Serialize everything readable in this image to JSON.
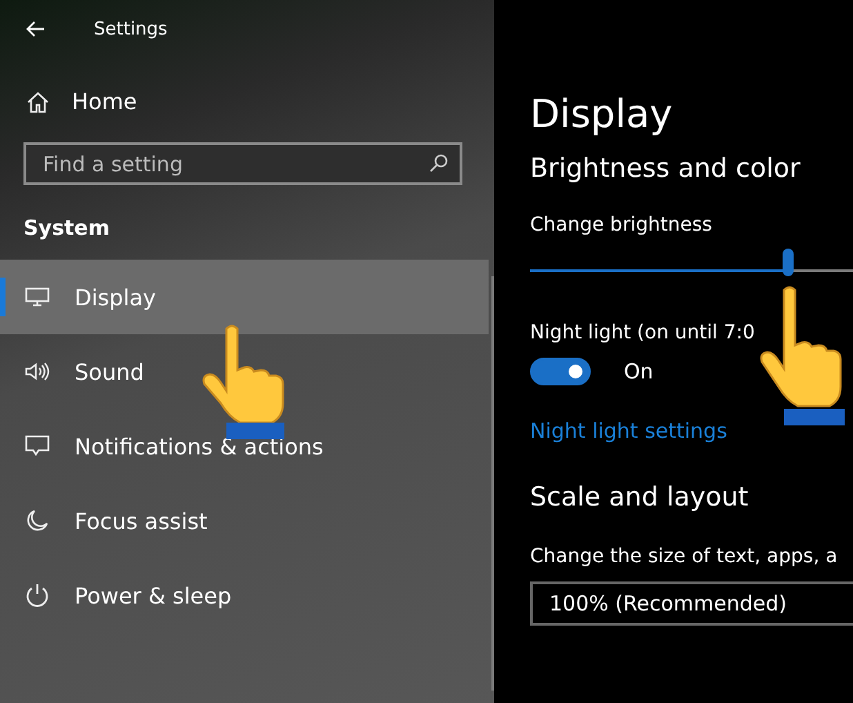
{
  "window": {
    "title": "Settings"
  },
  "home": {
    "label": "Home"
  },
  "search": {
    "placeholder": "Find a setting"
  },
  "section": "System",
  "nav": [
    {
      "label": "Display",
      "kind": "monitor",
      "selected": true
    },
    {
      "label": "Sound",
      "kind": "speaker",
      "selected": false
    },
    {
      "label": "Notifications & actions",
      "kind": "message",
      "selected": false
    },
    {
      "label": "Focus assist",
      "kind": "moon",
      "selected": false
    },
    {
      "label": "Power & sleep",
      "kind": "power",
      "selected": false
    }
  ],
  "page": {
    "title": "Display",
    "heading": "Brightness and color",
    "brightness": {
      "label": "Change brightness",
      "level": 0.8
    },
    "night_light": {
      "label": "Night light (on until 7:0",
      "on": true,
      "state": "On"
    },
    "link": "Night light settings",
    "scale_heading": "Scale and layout",
    "scale_label": "Change the size of text, apps, a",
    "scale_value": "100% (Recommended)"
  }
}
